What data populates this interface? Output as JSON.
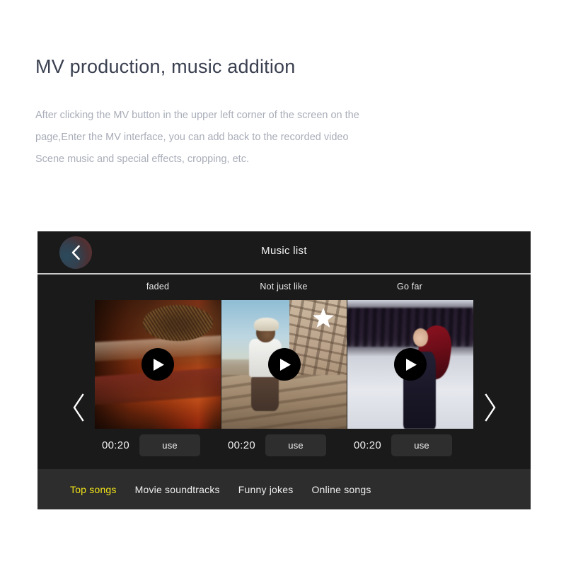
{
  "article": {
    "title": "MV production, music addition",
    "description_lines": [
      "After clicking the MV button in the upper left corner of the screen on the",
      "page,Enter the MV interface, you can add back to the recorded video",
      "Scene music and special effects, cropping, etc."
    ]
  },
  "app": {
    "header": {
      "title": "Music list",
      "back_icon": "chevron-left-icon"
    },
    "carousel": {
      "prev_icon": "chevron-left-icon",
      "next_icon": "chevron-right-icon",
      "tracks": [
        {
          "title": "faded",
          "duration": "00:20",
          "use_label": "use",
          "play_icon": "play-icon",
          "featured": false,
          "thumbnail": "stacked-books-with-nest"
        },
        {
          "title": "Not just like",
          "duration": "00:20",
          "use_label": "use",
          "play_icon": "play-icon",
          "featured": true,
          "badge_icon": "star-icon",
          "thumbnail": "boy-at-stone-wall"
        },
        {
          "title": "Go far",
          "duration": "00:20",
          "use_label": "use",
          "play_icon": "play-icon",
          "featured": false,
          "thumbnail": "woman-in-snow"
        }
      ]
    },
    "tabs": [
      {
        "label": "Top songs",
        "active": true
      },
      {
        "label": "Movie soundtracks",
        "active": false
      },
      {
        "label": "Funny jokes",
        "active": false
      },
      {
        "label": "Online songs",
        "active": false
      }
    ]
  },
  "colors": {
    "page_background": "#ffffff",
    "title_text": "#3a4050",
    "body_text": "#a9adb8",
    "panel_background": "#1a1a1a",
    "footer_background": "#2d2d2d",
    "active_tab": "#f2e318",
    "use_button": "#2e2e2e"
  }
}
